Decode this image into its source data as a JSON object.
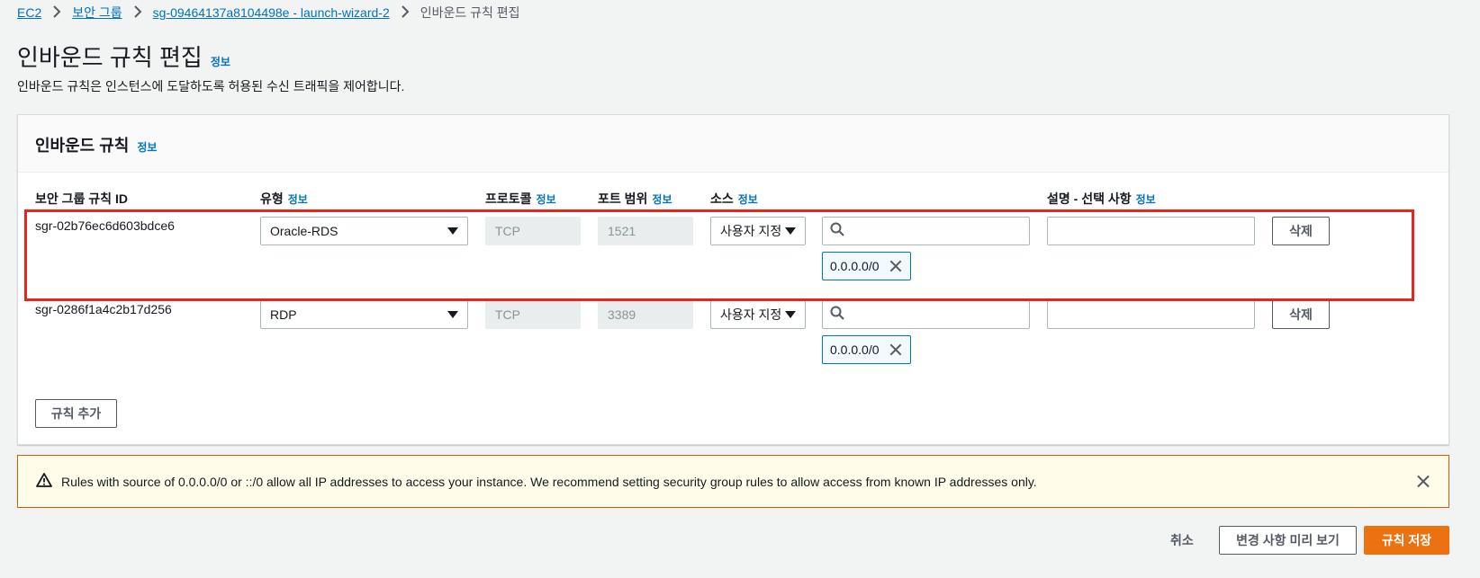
{
  "breadcrumb": {
    "items": [
      "EC2",
      "보안 그룹",
      "sg-09464137a8104498e - launch-wizard-2"
    ],
    "current": "인바운드 규칙 편집"
  },
  "page": {
    "title": "인바운드 규칙 편집",
    "info": "정보",
    "description": "인바운드 규칙은 인스턴스에 도달하도록 허용된 수신 트래픽을 제어합니다."
  },
  "panel": {
    "title": "인바운드 규칙",
    "info": "정보",
    "columns": {
      "rule_id": "보안 그룹 규칙 ID",
      "type": "유형",
      "protocol": "프로토콜",
      "port_range": "포트 범위",
      "source": "소스",
      "description": "설명 - 선택 사항"
    },
    "info_label": "정보",
    "rules": [
      {
        "id": "sgr-02b76ec6d603bdce6",
        "type": "Oracle-RDS",
        "protocol": "TCP",
        "port": "1521",
        "source_mode": "사용자 지정",
        "source_search": "",
        "cidr": "0.0.0.0/0",
        "description": "",
        "delete": "삭제"
      },
      {
        "id": "sgr-0286f1a4c2b17d256",
        "type": "RDP",
        "protocol": "TCP",
        "port": "3389",
        "source_mode": "사용자 지정",
        "source_search": "",
        "cidr": "0.0.0.0/0",
        "description": "",
        "delete": "삭제"
      }
    ],
    "add_rule": "규칙 추가"
  },
  "alert": {
    "text": "Rules with source of 0.0.0.0/0 or ::/0 allow all IP addresses to access your instance. We recommend setting security group rules to allow access from known IP addresses only."
  },
  "actions": {
    "cancel": "취소",
    "preview": "변경 사항 미리 보기",
    "save": "규칙 저장"
  },
  "colors": {
    "link": "#0073bb",
    "primary": "#ec7211",
    "highlight": "#e8251b",
    "warning_border": "#d45b07"
  }
}
